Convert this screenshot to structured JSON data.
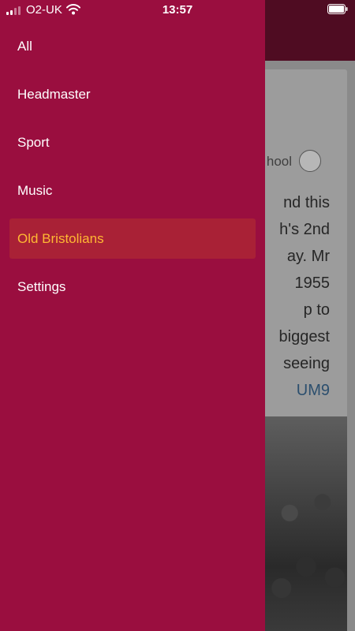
{
  "status_bar": {
    "carrier": "O2-UK",
    "time": "13:57"
  },
  "drawer": {
    "items": [
      {
        "label": "All",
        "active": false
      },
      {
        "label": "Headmaster",
        "active": false
      },
      {
        "label": "Sport",
        "active": false
      },
      {
        "label": "Music",
        "active": false
      },
      {
        "label": "Old Bristolians",
        "active": true
      },
      {
        "label": "Settings",
        "active": false
      }
    ]
  },
  "background_feed": {
    "source_name": "hool",
    "post_lines": [
      "nd this",
      "h's 2nd",
      "ay. Mr",
      "1955",
      "p to",
      "biggest",
      "seeing"
    ],
    "link_text": "UM9"
  },
  "colors": {
    "drawer_background": "#9a0e3f",
    "active_item_background": "#a92136",
    "active_item_text": "#ffb833",
    "header_background": "#4f0c22"
  }
}
